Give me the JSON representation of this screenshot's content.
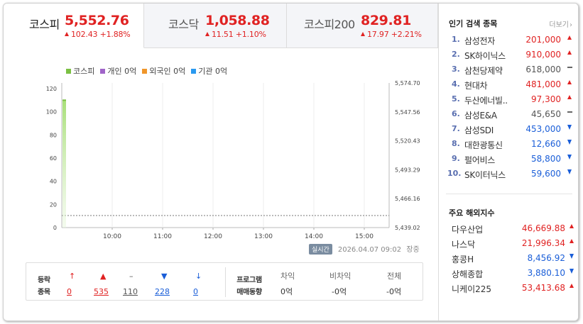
{
  "tabs": [
    {
      "name": "코스피",
      "price": "5,552.76",
      "change": "102.43 +1.88%",
      "active": true
    },
    {
      "name": "코스닥",
      "price": "1,058.88",
      "change": "11.51 +1.10%",
      "active": false
    },
    {
      "name": "코스피200",
      "price": "829.81",
      "change": "17.97 +2.21%",
      "active": false
    }
  ],
  "legend": [
    {
      "label": "코스피",
      "color": "#7bc043"
    },
    {
      "label": "개인 0억",
      "color": "#a064c8"
    },
    {
      "label": "외국인 0억",
      "color": "#f0962a"
    },
    {
      "label": "기관 0억",
      "color": "#2a9af0"
    }
  ],
  "chart_data": {
    "type": "area",
    "series": [
      {
        "name": "코스피",
        "x": [
          "09:00",
          "09:02"
        ],
        "values": [
          110,
          110
        ],
        "color": "#7bc043"
      }
    ],
    "y_left_ticks": [
      "120",
      "100",
      "80",
      "60",
      "40",
      "20",
      "0"
    ],
    "y_right_ticks": [
      "5,574.70",
      "5,547.56",
      "5,520.43",
      "5,493.29",
      "5,466.16",
      "5,439.02"
    ],
    "x_ticks": [
      "10:00",
      "11:00",
      "12:00",
      "13:00",
      "14:00",
      "15:00"
    ],
    "ylim": [
      0,
      120
    ]
  },
  "status": {
    "badge": "실시간",
    "datetime": "2026.04.07 09:02",
    "market_state": "장중"
  },
  "stats": {
    "label_line1": "등락",
    "label_line2": "종목",
    "items": [
      {
        "icon": "upper-limit-icon",
        "symbol": "↑",
        "value": "0",
        "color": "#e02222"
      },
      {
        "icon": "rise-icon",
        "symbol": "▲",
        "value": "535",
        "color": "#e02222"
      },
      {
        "icon": "flat-icon",
        "symbol": "–",
        "value": "110",
        "color": "#555555"
      },
      {
        "icon": "fall-icon",
        "symbol": "▼",
        "value": "228",
        "color": "#1a5ed8"
      },
      {
        "icon": "lower-limit-icon",
        "symbol": "↓",
        "value": "0",
        "color": "#1a5ed8"
      }
    ],
    "program_line1": "프로그램",
    "program_line2": "매매동향",
    "program": [
      {
        "header": "차익",
        "value": "0억"
      },
      {
        "header": "비차익",
        "value": "-0억"
      },
      {
        "header": "전체",
        "value": "-0억"
      }
    ]
  },
  "popular": {
    "title": "인기 검색 종목",
    "more": "더보기",
    "items": [
      {
        "rank": "1.",
        "name": "삼성전자",
        "price": "201,000",
        "dir": "up"
      },
      {
        "rank": "2.",
        "name": "SK하이닉스",
        "price": "910,000",
        "dir": "up"
      },
      {
        "rank": "3.",
        "name": "삼천당제약",
        "price": "618,000",
        "dir": "flat"
      },
      {
        "rank": "4.",
        "name": "현대차",
        "price": "481,000",
        "dir": "up"
      },
      {
        "rank": "5.",
        "name": "두산에너빌..",
        "price": "97,300",
        "dir": "up"
      },
      {
        "rank": "6.",
        "name": "삼성E&A",
        "price": "45,650",
        "dir": "flat"
      },
      {
        "rank": "7.",
        "name": "삼성SDI",
        "price": "453,000",
        "dir": "down"
      },
      {
        "rank": "8.",
        "name": "대한광통신",
        "price": "12,660",
        "dir": "down"
      },
      {
        "rank": "9.",
        "name": "펄어비스",
        "price": "58,800",
        "dir": "down"
      },
      {
        "rank": "10.",
        "name": "SK이터닉스",
        "price": "59,600",
        "dir": "down"
      }
    ]
  },
  "overseas": {
    "title": "주요 해외지수",
    "items": [
      {
        "name": "다우산업",
        "price": "46,669.88",
        "dir": "up"
      },
      {
        "name": "나스닥",
        "price": "21,996.34",
        "dir": "up"
      },
      {
        "name": "홍콩H",
        "price": "8,456.92",
        "dir": "down"
      },
      {
        "name": "상해종합",
        "price": "3,880.10",
        "dir": "down"
      },
      {
        "name": "니케이225",
        "price": "53,413.68",
        "dir": "up"
      }
    ]
  }
}
